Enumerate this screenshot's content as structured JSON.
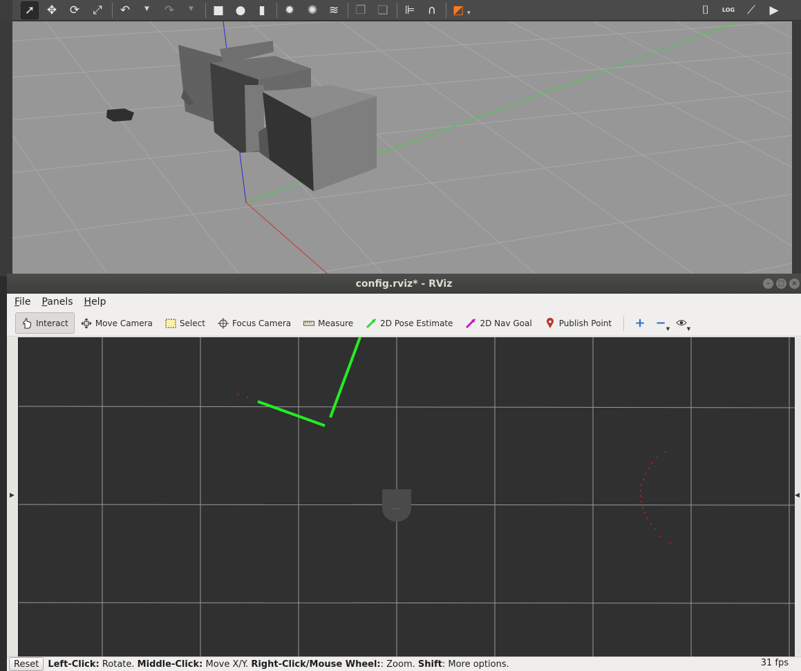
{
  "gazebo": {
    "tools": [
      {
        "icon": "select-arrow-icon",
        "glyph": "➚"
      },
      {
        "icon": "translate-icon",
        "glyph": "✥"
      },
      {
        "icon": "rotate-icon",
        "glyph": "⟳"
      },
      {
        "icon": "scale-icon",
        "glyph": "⤢"
      },
      {
        "icon": "undo-icon",
        "glyph": "↶"
      },
      {
        "icon": "redo-icon",
        "glyph": "↷"
      },
      {
        "icon": "box-icon",
        "glyph": "■"
      },
      {
        "icon": "sphere-icon",
        "glyph": "●"
      },
      {
        "icon": "cylinder-icon",
        "glyph": "▮"
      },
      {
        "icon": "point-light-icon",
        "glyph": "✹"
      },
      {
        "icon": "spot-light-icon",
        "glyph": "✺"
      },
      {
        "icon": "directional-light-icon",
        "glyph": "≋"
      },
      {
        "icon": "copy-icon",
        "glyph": "❐"
      },
      {
        "icon": "paste-icon",
        "glyph": "❏"
      },
      {
        "icon": "align-icon",
        "glyph": "⊫"
      },
      {
        "icon": "snap-icon",
        "glyph": "∩"
      },
      {
        "icon": "view-angle-icon",
        "glyph": "◩"
      }
    ],
    "right_tools": [
      {
        "icon": "screenshot-camera-icon",
        "glyph": "⌷"
      },
      {
        "icon": "log-icon",
        "glyph": "LOG"
      },
      {
        "icon": "plot-icon",
        "glyph": "⟋"
      },
      {
        "icon": "video-record-icon",
        "glyph": "▶"
      }
    ]
  },
  "rviz": {
    "window_title": "config.rviz* - RViz",
    "menu": [
      {
        "label": "File",
        "accel": "F",
        "rest": "ile"
      },
      {
        "label": "Panels",
        "accel": "P",
        "rest": "anels"
      },
      {
        "label": "Help",
        "accel": "H",
        "rest": "elp"
      }
    ],
    "tools": [
      {
        "label": "Interact",
        "icon": "hand-pointer-icon",
        "active": true
      },
      {
        "label": "Move Camera",
        "icon": "move-camera-icon",
        "active": false
      },
      {
        "label": "Select",
        "icon": "select-rect-icon",
        "active": false
      },
      {
        "label": "Focus Camera",
        "icon": "focus-camera-icon",
        "active": false
      },
      {
        "label": "Measure",
        "icon": "ruler-icon",
        "active": false
      },
      {
        "label": "2D Pose Estimate",
        "icon": "pose-estimate-arrow-icon",
        "active": false
      },
      {
        "label": "2D Nav Goal",
        "icon": "nav-goal-arrow-icon",
        "active": false
      },
      {
        "label": "Publish Point",
        "icon": "map-pin-icon",
        "active": false
      }
    ],
    "status": {
      "reset_label": "Reset",
      "hint_parts": [
        {
          "bold": "Left-Click:",
          "text": " Rotate. "
        },
        {
          "bold": "Middle-Click:",
          "text": " Move X/Y. "
        },
        {
          "bold": "Right-Click/Mouse Wheel:",
          "text": ": Zoom. "
        },
        {
          "bold": "Shift",
          "text": ": More options."
        }
      ],
      "fps": "31 fps"
    },
    "colors": {
      "laser_scan": "#22ee22",
      "point_cloud": "#b42020",
      "grid": "#9a9a9a",
      "viewport_bg": "#303030"
    }
  }
}
